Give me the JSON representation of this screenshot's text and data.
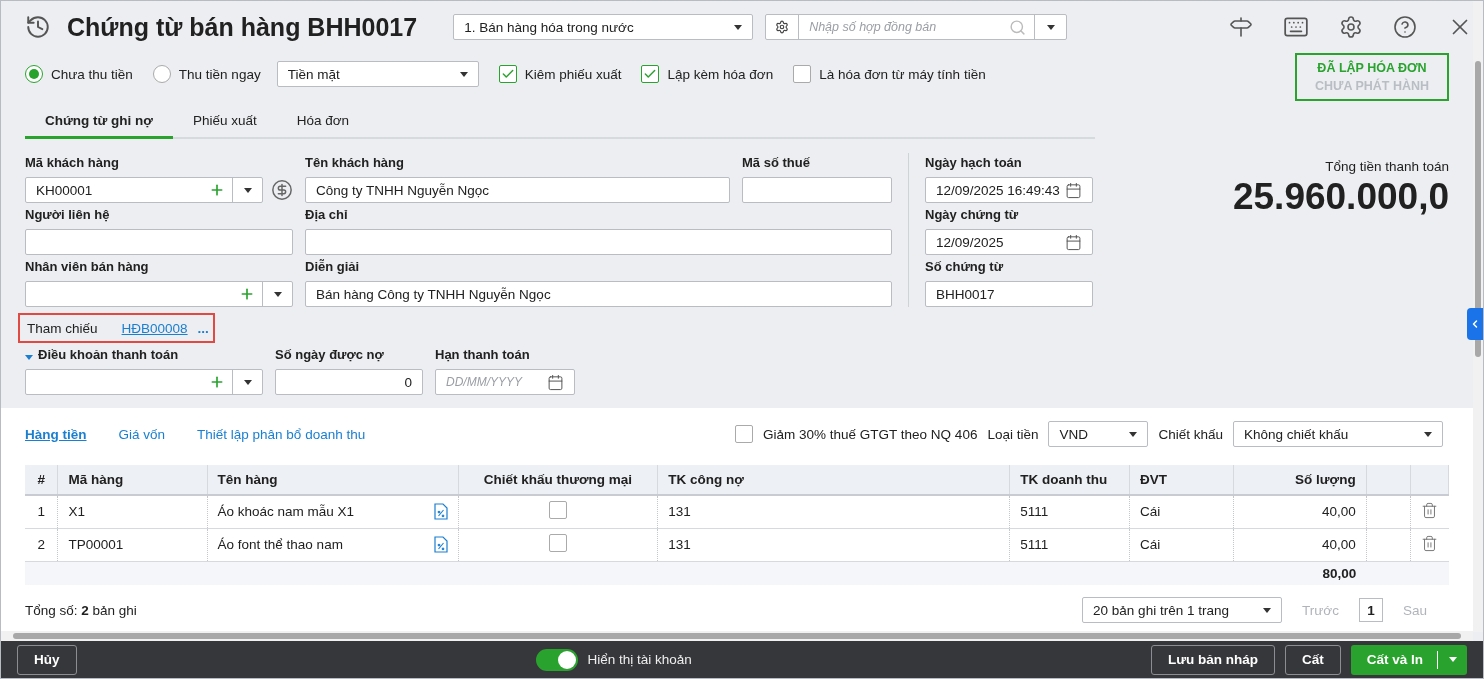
{
  "header": {
    "title": "Chứng từ bán hàng BHH0017",
    "type_select": "1. Bán hàng hóa trong nước",
    "contract_search": {
      "placeholder": "Nhập số hợp đồng bán"
    }
  },
  "payment_options": {
    "radios": [
      {
        "label": "Chưa thu tiền",
        "selected": true
      },
      {
        "label": "Thu tiền ngay",
        "selected": false
      }
    ],
    "method_select": "Tiền mặt",
    "checkboxes": [
      {
        "label": "Kiêm phiếu xuất",
        "checked": true
      },
      {
        "label": "Lập kèm hóa đơn",
        "checked": true
      },
      {
        "label": "Là hóa đơn từ máy tính tiền",
        "checked": false
      }
    ]
  },
  "status_stamp": [
    {
      "text": "ĐÃ LẬP HÓA ĐƠN",
      "active": true
    },
    {
      "text": "CHƯA PHÁT HÀNH",
      "active": false
    }
  ],
  "tabs": [
    {
      "label": "Chứng từ ghi nợ",
      "selected": true
    },
    {
      "label": "Phiếu xuất",
      "selected": false
    },
    {
      "label": "Hóa đơn",
      "selected": false
    }
  ],
  "form": {
    "customer_code": {
      "label": "Mã khách hàng",
      "value": "KH00001"
    },
    "customer_name": {
      "label": "Tên khách hàng",
      "value": "Công ty TNHH Nguyễn Ngọc"
    },
    "tax_code": {
      "label": "Mã số thuế"
    },
    "contact": {
      "label": "Người liên hệ"
    },
    "address": {
      "label": "Địa chỉ"
    },
    "salesperson": {
      "label": "Nhân viên bán hàng"
    },
    "description": {
      "label": "Diễn giải",
      "value": "Bán hàng Công ty TNHH Nguyễn Ngọc"
    },
    "posting_date": {
      "label": "Ngày hạch toán",
      "value": "12/09/2025 16:49:43"
    },
    "voucher_date": {
      "label": "Ngày chứng từ",
      "value": "12/09/2025"
    },
    "voucher_no": {
      "label": "Số chứng từ",
      "value": "BHH0017"
    }
  },
  "total": {
    "label": "Tổng tiền thanh toán",
    "value": "25.960.000,0"
  },
  "reference": {
    "label": "Tham chiếu",
    "link": "HĐB00008",
    "more": "..."
  },
  "terms": {
    "payment_terms": {
      "label": "Điều khoản thanh toán",
      "expanded": true
    },
    "credit_days": {
      "label": "Số ngày được nợ",
      "value": "0"
    },
    "due_date": {
      "label": "Hạn thanh toán",
      "placeholder": "DD/MM/YYYY"
    }
  },
  "detail_tabs": [
    {
      "label": "Hàng tiền",
      "selected": true
    },
    {
      "label": "Giá vốn",
      "selected": false
    },
    {
      "label": "Thiết lập phân bổ doanh thu",
      "selected": false
    }
  ],
  "tax_reduction": {
    "label": "Giảm 30% thuế GTGT theo NQ 406",
    "checked": false
  },
  "currency": {
    "label": "Loại tiền",
    "value": "VND"
  },
  "discount": {
    "label": "Chiết khấu",
    "value": "Không chiết khấu"
  },
  "table": {
    "columns": [
      "#",
      "Mã hàng",
      "Tên hàng",
      "Chiết khấu thương mại",
      "TK công nợ",
      "TK doanh thu",
      "ĐVT",
      "Số lượng"
    ],
    "rows": [
      {
        "index": "1",
        "code": "X1",
        "name": "Áo khoác nam mẫu X1",
        "trade_discount": false,
        "debit_account": "131",
        "revenue_account": "5111",
        "unit": "Cái",
        "quantity": "40,00"
      },
      {
        "index": "2",
        "code": "TP00001",
        "name": "Áo font thể thao nam",
        "trade_discount": false,
        "debit_account": "131",
        "revenue_account": "5111",
        "unit": "Cái",
        "quantity": "40,00"
      }
    ],
    "total_quantity": "80,00"
  },
  "summary": "Tổng số: **2** bản ghi",
  "pagination": {
    "page_size": "20 bản ghi trên 1 trang",
    "prev": {
      "label": "Trước",
      "disabled": true
    },
    "page": "1",
    "next": {
      "label": "Sau",
      "disabled": true
    }
  },
  "footer": {
    "cancel": "Hủy",
    "toggle": {
      "label": "Hiển thị tài khoản",
      "on": true
    },
    "buttons": [
      "Lưu bản nháp",
      "Cất"
    ],
    "primary": "Cất và In"
  }
}
